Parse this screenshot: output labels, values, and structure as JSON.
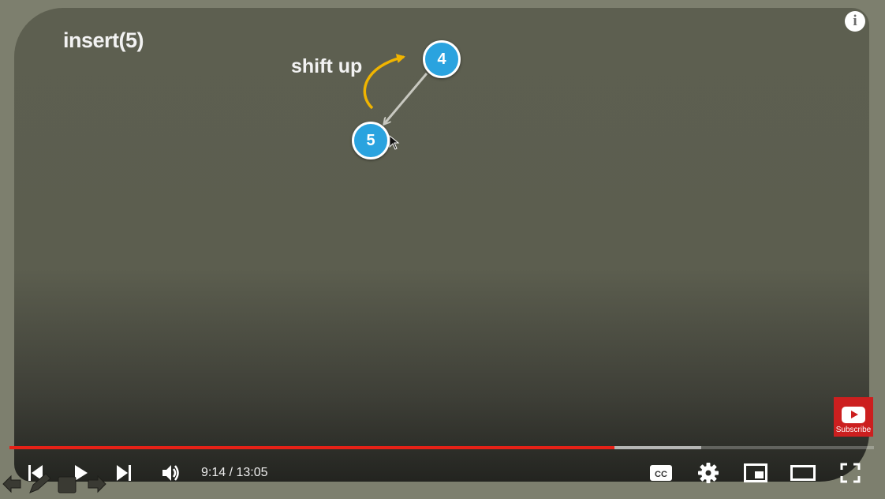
{
  "video": {
    "slide": {
      "title": "insert(5)",
      "annotation": "shift up",
      "nodes": [
        {
          "value": "4"
        },
        {
          "value": "5"
        }
      ],
      "colors": {
        "node": "#2aa3df",
        "arrow": "#f0b400",
        "edge": "#c8c8c0"
      }
    },
    "info_icon": "info-icon",
    "subscribe_label": "Subscribe"
  },
  "player": {
    "progress": {
      "played_fraction": 0.7,
      "buffered_fraction": 0.8
    },
    "time": "9:14 / 13:05",
    "icons": [
      "previous-icon",
      "play-icon",
      "next-icon",
      "volume-icon",
      "closed-captions-icon",
      "settings-icon",
      "miniplayer-icon",
      "theater-mode-icon",
      "fullscreen-icon"
    ],
    "cc_label": "CC",
    "accent": "#e62117"
  }
}
